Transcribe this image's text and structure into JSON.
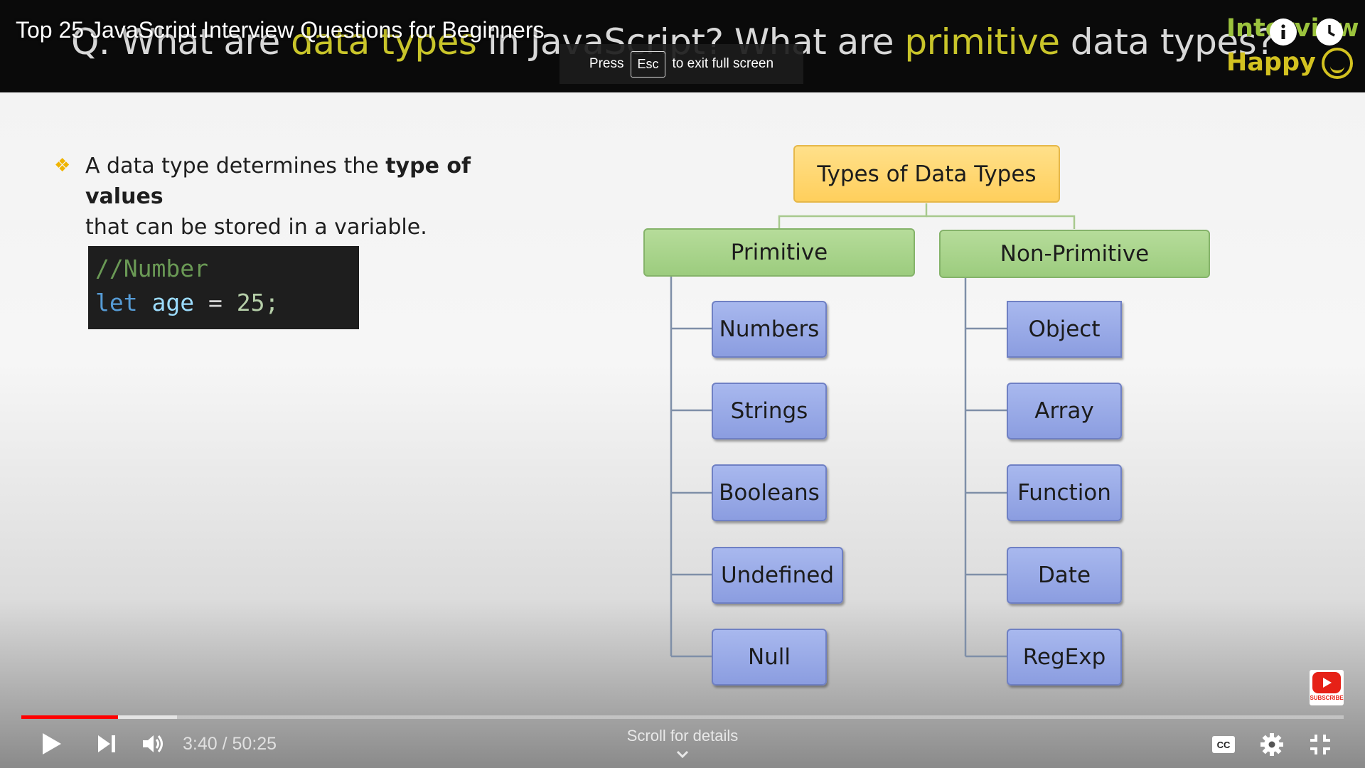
{
  "video": {
    "title": "Top 25 JavaScript Interview Questions for Beginners",
    "time_current": "3:40",
    "time_separator": " / ",
    "time_total": "50:25",
    "progress_played": 0.073,
    "progress_buffered": 0.118
  },
  "fullscreen_hint": {
    "press": "Press",
    "key": "Esc",
    "suffix": "to exit full screen"
  },
  "slide": {
    "question_prefix": "Q. What are ",
    "question_highlight": "data types",
    "question_middle": " in JavaScript? What are ",
    "question_highlight2": "primitive",
    "question_suffix": " data types?",
    "brand_line1": "Interview",
    "brand_line2": "Happy",
    "bullet_plain1": "A data type determines the ",
    "bullet_bold": "type of values",
    "bullet_plain2": "that can be stored in a variable.",
    "code_comment": "//Number",
    "code_let": "let",
    "code_var": "age",
    "code_op": "=",
    "code_num": "25;"
  },
  "diagram": {
    "root": "Types of Data Types",
    "primitive": {
      "label": "Primitive",
      "items": [
        "Numbers",
        "Strings",
        "Booleans",
        "Undefined",
        "Null"
      ]
    },
    "non_primitive": {
      "label": "Non-Primitive",
      "items": [
        "Object",
        "Array",
        "Function",
        "Date",
        "RegExp"
      ]
    }
  },
  "controls": {
    "scroll_hint": "Scroll for details",
    "subscribe_label": "SUBSCRIBE",
    "icons": [
      "play-icon",
      "next-icon",
      "volume-icon",
      "captions-icon",
      "settings-icon",
      "exit-fullscreen-icon",
      "info-icon",
      "watch-later-icon"
    ]
  },
  "colors": {
    "progress_played": "#ff0000",
    "root_node": "#ffd36e",
    "category_node": "#a9d48c",
    "leaf_node": "#99aae6"
  }
}
